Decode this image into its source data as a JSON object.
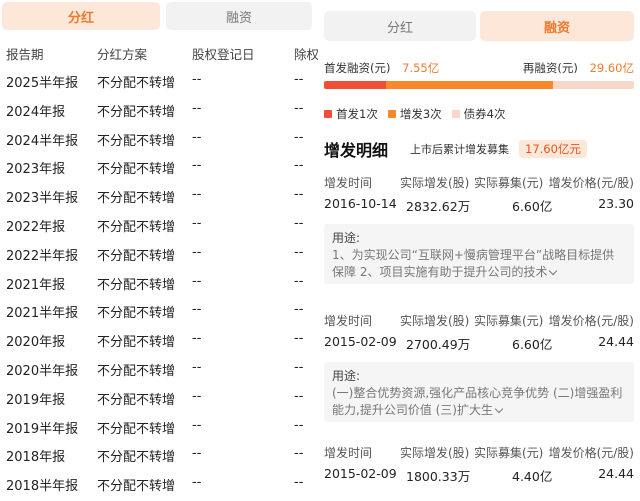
{
  "left": {
    "tabs": [
      {
        "label": "分红",
        "active": true
      },
      {
        "label": "融资",
        "active": false
      }
    ],
    "headers": [
      "报告期",
      "分红方案",
      "股权登记日",
      "除权"
    ],
    "rows": [
      [
        "2025半年报",
        "不分配不转增",
        "--",
        "--"
      ],
      [
        "2024年报",
        "不分配不转增",
        "--",
        "--"
      ],
      [
        "2024半年报",
        "不分配不转增",
        "--",
        "--"
      ],
      [
        "2023年报",
        "不分配不转增",
        "--",
        "--"
      ],
      [
        "2023半年报",
        "不分配不转增",
        "--",
        "--"
      ],
      [
        "2022年报",
        "不分配不转增",
        "--",
        "--"
      ],
      [
        "2022半年报",
        "不分配不转增",
        "--",
        "--"
      ],
      [
        "2021年报",
        "不分配不转增",
        "--",
        "--"
      ],
      [
        "2021半年报",
        "不分配不转增",
        "--",
        "--"
      ],
      [
        "2020年报",
        "不分配不转增",
        "--",
        "--"
      ],
      [
        "2020半年报",
        "不分配不转增",
        "--",
        "--"
      ],
      [
        "2019年报",
        "不分配不转增",
        "--",
        "--"
      ],
      [
        "2019半年报",
        "不分配不转增",
        "--",
        "--"
      ],
      [
        "2018年报",
        "不分配不转增",
        "--",
        "--"
      ],
      [
        "2018半年报",
        "不分配不转增",
        "--",
        "--"
      ]
    ]
  },
  "right": {
    "tabs": [
      {
        "label": "分红",
        "active": false
      },
      {
        "label": "融资",
        "active": true
      }
    ],
    "first_financing_label": "首发融资(元)",
    "first_financing_value": "7.55亿",
    "refinancing_label": "再融资(元)",
    "refinancing_value": "29.60亿",
    "financing_bar": [
      {
        "name": "首发",
        "share": 0.2,
        "color": "#f04e37"
      },
      {
        "name": "增发",
        "share": 0.54,
        "color": "#f7892b"
      },
      {
        "name": "债券",
        "share": 0.26,
        "color": "#f6d7c8"
      }
    ],
    "legend": [
      {
        "text": "首发1次",
        "color": "#f04e37"
      },
      {
        "text": "增发3次",
        "color": "#f7892b"
      },
      {
        "text": "债券4次",
        "color": "#f6d7c8"
      }
    ],
    "section_title": "增发明细",
    "summary_label": "上市后累计增发募集",
    "summary_value": "17.60亿元",
    "issue_headers": [
      "增发时间",
      "实际增发(股)",
      "实际募集(元)",
      "增发价格(元/股)"
    ],
    "issues": [
      {
        "date": "2016-10-14",
        "shares": "2832.62万",
        "raised": "6.60亿",
        "price": "23.30",
        "purpose_label": "用途:",
        "purpose_text": "1、为实现公司“互联网+慢病管理平台”战略目标提供保障 2、项目实施有助于提升公司的技术"
      },
      {
        "date": "2015-02-09",
        "shares": "2700.49万",
        "raised": "6.60亿",
        "price": "24.44",
        "purpose_label": "用途:",
        "purpose_text": "(一)整合优势资源,强化产品核心竞争优势 (二)增强盈利能力,提升公司价值 (三)扩大生"
      },
      {
        "date": "2015-02-09",
        "shares": "1800.33万",
        "raised": "4.40亿",
        "price": "24.44"
      }
    ]
  }
}
